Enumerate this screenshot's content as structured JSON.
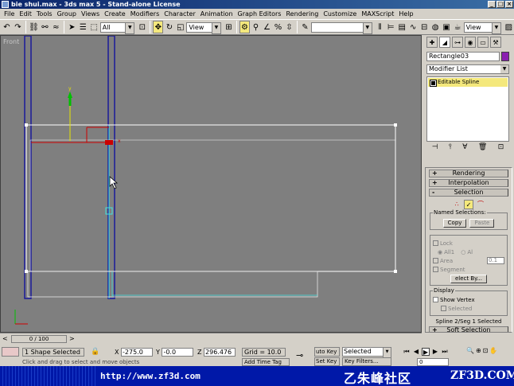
{
  "window": {
    "title": "bie shui.max - 3ds max 5 - Stand-alone License",
    "buttons": [
      "_",
      "□",
      "×"
    ]
  },
  "menu": [
    "File",
    "Edit",
    "Tools",
    "Group",
    "Views",
    "Create",
    "Modifiers",
    "Character",
    "Animation",
    "Graph Editors",
    "Rendering",
    "Customize",
    "MAXScript",
    "Help"
  ],
  "toolbar": {
    "selection_filter": "All",
    "reference_coord": "View",
    "named_selection": "",
    "render_view": "View"
  },
  "viewport": {
    "label": "Front",
    "axis_labels": {
      "x": "x",
      "y": "y"
    }
  },
  "command_panel": {
    "object_name": "Rectangle03",
    "object_color": "#8a1fb0",
    "modifier_list": "Modifier List",
    "stack_item": "Editable Spline",
    "rollouts": {
      "rendering": "Rendering",
      "interpolation": "Interpolation",
      "selection": "Selection",
      "soft_selection": "Soft Selection"
    },
    "rollout_sign": {
      "plus": "+",
      "minus": "-"
    },
    "named_selections": {
      "label": "Named Selections:",
      "copy": "Copy",
      "paste": "Paste"
    },
    "lock": "Lock",
    "all1": "All1",
    "al": "Al",
    "area": "Area",
    "area_value": "0.1",
    "segment": "Segment",
    "select_by": "elect By...",
    "display": {
      "label": "Display",
      "show_vertex": "Show Vertex",
      "selected": "Selected"
    },
    "selection_status": "Spline 2/Seg 1 Selected"
  },
  "timeline": {
    "frame_text": "0 / 100",
    "left_arrow": "<",
    "right_arrow": ">"
  },
  "status": {
    "selection": "1 Shape Selected",
    "x_label": "X",
    "y_label": "Y",
    "z_label": "Z",
    "x": "-275.0",
    "y": "-0.0",
    "z": "296.476",
    "grid": "Grid = 10.0",
    "auto_key": "uto Key",
    "set_key": "Set Key",
    "key_mode": "Selected",
    "key_filters": "Key Filters...",
    "prompt": "Click and drag to select and move objects",
    "add_time_tag": "Add Time Tag",
    "frame": "0"
  },
  "banner": {
    "url": "http://www.zf3d.com",
    "brand_cn": "乙朱峰社区",
    "brand_en": "ZF3D.COM"
  }
}
